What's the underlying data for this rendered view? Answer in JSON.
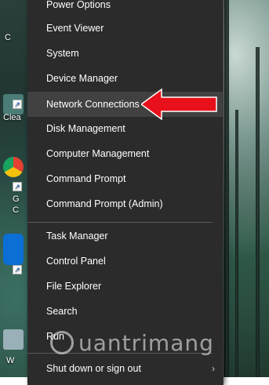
{
  "menu": {
    "items": [
      {
        "label": "Power Options"
      },
      {
        "label": "Event Viewer"
      },
      {
        "label": "System"
      },
      {
        "label": "Device Manager"
      },
      {
        "label": "Network Connections"
      },
      {
        "label": "Disk Management"
      },
      {
        "label": "Computer Management"
      },
      {
        "label": "Command Prompt"
      },
      {
        "label": "Command Prompt (Admin)"
      },
      {
        "label": "Task Manager"
      },
      {
        "label": "Control Panel"
      },
      {
        "label": "File Explorer"
      },
      {
        "label": "Search"
      },
      {
        "label": "Run"
      },
      {
        "label": "Shut down or sign out"
      }
    ],
    "highlighted_item": "Network Connections",
    "submenu_glyph": "›"
  },
  "desktop": {
    "icons": [
      {
        "label": "C"
      },
      {
        "label": "Clea"
      },
      {
        "label": "G"
      },
      {
        "label": "C"
      },
      {
        "label": "W"
      }
    ]
  },
  "watermark": {
    "text": "uantrimang"
  },
  "colors": {
    "menu_bg": "#2b2b2b",
    "menu_hover": "#414141",
    "pointer_arrow": "#e8101a"
  }
}
